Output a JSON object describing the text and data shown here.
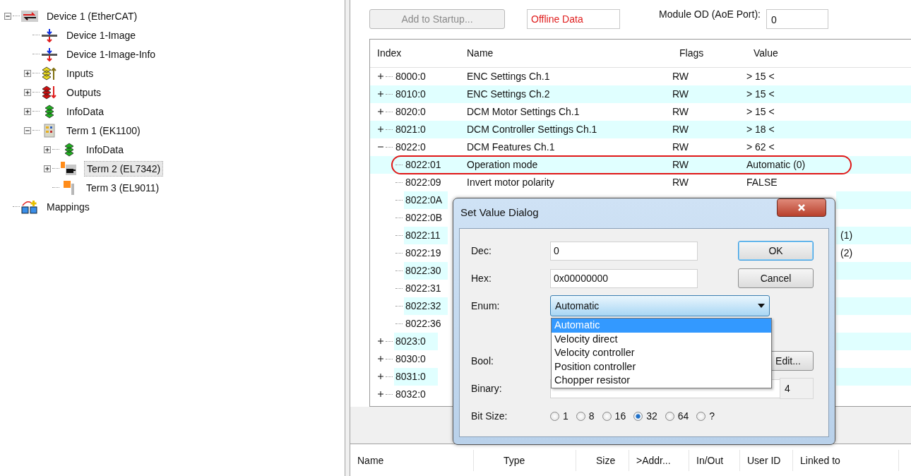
{
  "tree": [
    {
      "label": "Device 1 (EtherCAT)",
      "kind": "device",
      "expanded": true,
      "selected": false,
      "children": [
        {
          "label": "Device 1-Image",
          "kind": "image",
          "selected": false
        },
        {
          "label": "Device 1-Image-Info",
          "kind": "image",
          "selected": false
        },
        {
          "label": "Inputs",
          "kind": "inputs",
          "expanded": false,
          "selected": false
        },
        {
          "label": "Outputs",
          "kind": "outputs",
          "expanded": false,
          "selected": false
        },
        {
          "label": "InfoData",
          "kind": "infodata",
          "expanded": false,
          "selected": false
        },
        {
          "label": "Term 1 (EK1100)",
          "kind": "coupler",
          "expanded": true,
          "selected": false,
          "children": [
            {
              "label": "InfoData",
              "kind": "infodata",
              "expanded": false,
              "selected": false
            },
            {
              "label": "Term 2 (EL7342)",
              "kind": "terminal-motor",
              "expanded": false,
              "selected": true
            },
            {
              "label": "Term 3 (EL9011)",
              "kind": "terminal-end",
              "selected": false
            }
          ]
        }
      ]
    },
    {
      "label": "Mappings",
      "kind": "mappings",
      "selected": false
    }
  ],
  "toolbar": {
    "startup_button": {
      "label": "Add to Startup...",
      "disabled": true
    },
    "status": "Offline Data",
    "module_od_label": "Module OD (AoE Port):",
    "module_od_value": "0"
  },
  "table": {
    "columns": [
      "Index",
      "Name",
      "Flags",
      "Value"
    ],
    "rows": [
      {
        "index": "8000:0",
        "name": "ENC Settings Ch.1",
        "flags": "RW",
        "value": "> 15 <",
        "expanded": false,
        "highlighted": false
      },
      {
        "index": "8010:0",
        "name": "ENC Settings Ch.2",
        "flags": "RW",
        "value": "> 15 <",
        "expanded": false,
        "highlighted": false
      },
      {
        "index": "8020:0",
        "name": "DCM Motor Settings Ch.1",
        "flags": "RW",
        "value": "> 15 <",
        "expanded": false,
        "highlighted": false
      },
      {
        "index": "8021:0",
        "name": "DCM Controller Settings Ch.1",
        "flags": "RW",
        "value": "> 18 <",
        "expanded": false,
        "highlighted": false
      },
      {
        "index": "8022:0",
        "name": "DCM Features Ch.1",
        "flags": "RW",
        "value": "> 62 <",
        "expanded": true,
        "highlighted": false
      },
      {
        "index": "8022:01",
        "name": "Operation mode",
        "flags": "RW",
        "value": "Automatic (0)",
        "highlighted": true
      },
      {
        "index": "8022:09",
        "name": "Invert motor polarity",
        "flags": "RW",
        "value": "FALSE",
        "highlighted": false
      },
      {
        "index": "8022:0A",
        "covered": true,
        "highlighted": false
      },
      {
        "index": "8022:0B",
        "covered": true,
        "highlighted": false
      },
      {
        "index": "8022:11",
        "value": "(1)",
        "covered": true,
        "highlighted": false
      },
      {
        "index": "8022:19",
        "value": "(2)",
        "covered": true,
        "highlighted": false
      },
      {
        "index": "8022:30",
        "covered": true,
        "highlighted": false
      },
      {
        "index": "8022:31",
        "covered": true,
        "highlighted": false
      },
      {
        "index": "8022:32",
        "covered": true,
        "highlighted": false
      },
      {
        "index": "8022:36",
        "covered": true,
        "highlighted": false
      },
      {
        "index": "8023:0",
        "expanded": false,
        "covered": true,
        "highlighted": false
      },
      {
        "index": "8030:0",
        "expanded": false,
        "covered": true,
        "highlighted": false
      },
      {
        "index": "8031:0",
        "expanded": false,
        "covered": true,
        "highlighted": false
      },
      {
        "index": "8032:0",
        "expanded": false,
        "covered": true,
        "highlighted": false
      }
    ]
  },
  "dialog": {
    "title": "Set Value Dialog",
    "fields": [
      {
        "label": "Dec:",
        "value": "0"
      },
      {
        "label": "Hex:",
        "value": "0x00000000"
      }
    ],
    "buttons": [
      {
        "label": "OK",
        "default": true
      },
      {
        "label": "Cancel",
        "default": false
      }
    ],
    "enum": {
      "label": "Enum:",
      "value": "Automatic",
      "options": [
        {
          "label": "Automatic",
          "selected": true
        },
        {
          "label": "Velocity direct",
          "selected": false
        },
        {
          "label": "Velocity controller",
          "selected": false
        },
        {
          "label": "Position controller",
          "selected": false
        },
        {
          "label": "Chopper resistor",
          "selected": false
        }
      ]
    },
    "bool_label": "Bool:",
    "edit_button": "Edit...",
    "binary_label": "Binary:",
    "size_value": "4",
    "bit_size": {
      "label": "Bit Size:",
      "options": [
        {
          "label": "1",
          "selected": false
        },
        {
          "label": "8",
          "selected": false
        },
        {
          "label": "16",
          "selected": false
        },
        {
          "label": "32",
          "selected": true
        },
        {
          "label": "64",
          "selected": false
        },
        {
          "label": "?",
          "selected": false
        }
      ]
    }
  },
  "variables": {
    "columns": [
      "Name",
      "Type",
      "Size",
      ">Addr...",
      "In/Out",
      "User ID",
      "Linked to"
    ]
  }
}
